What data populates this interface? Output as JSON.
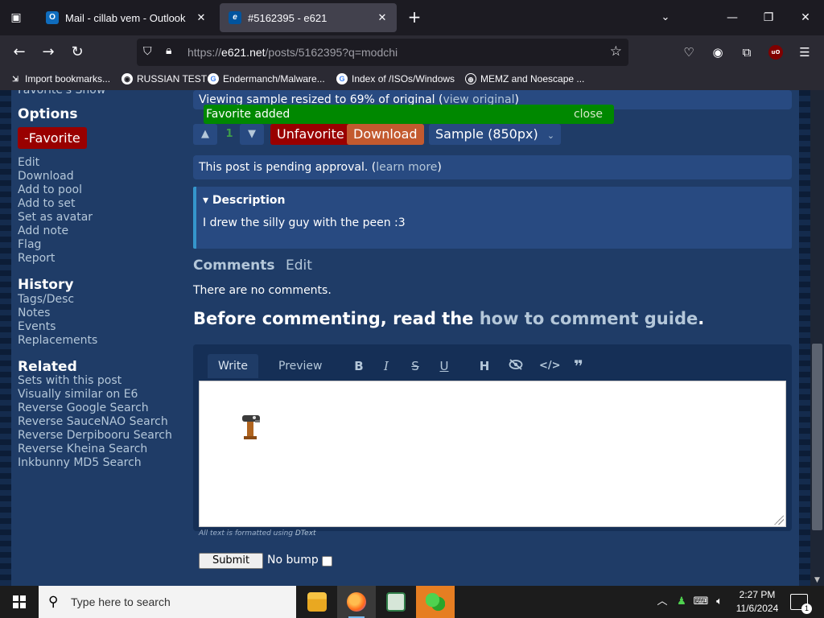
{
  "browser": {
    "tabs": [
      {
        "title": "Mail - cillab vem - Outlook",
        "favicon": "outlook-icon",
        "active": false
      },
      {
        "title": "#5162395 - e621",
        "favicon": "e621-icon",
        "active": true
      }
    ],
    "url": {
      "prefix": "https://",
      "host": "e621.net",
      "rest": "/posts/5162395?q=modchi"
    },
    "bookmarks": [
      {
        "label": "Import bookmarks...",
        "icon": "import-icon"
      },
      {
        "label": "RUSSIAN TEST",
        "icon": "github-icon"
      },
      {
        "label": "Endermanch/Malware...",
        "icon": "google-icon"
      },
      {
        "label": "Index of /ISOs/Windows",
        "icon": "google-icon"
      },
      {
        "label": "MEMZ and Noescape ...",
        "icon": "globe-icon"
      }
    ],
    "ublock_label": "uO"
  },
  "sidebar": {
    "cut_text": "Favorite's Show",
    "options_heading": "Options",
    "favorite_button": "-Favorite",
    "options": [
      "Edit",
      "Download",
      "Add to pool",
      "Add to set",
      "Set as avatar",
      "Add note",
      "Flag",
      "Report"
    ],
    "history_heading": "History",
    "history": [
      "Tags/Desc",
      "Notes",
      "Events",
      "Replacements"
    ],
    "related_heading": "Related",
    "related": [
      "Sets with this post",
      "Visually similar on E6",
      "Reverse Google Search",
      "Reverse SauceNAO Search",
      "Reverse Derpibooru Search",
      "Reverse Kheina Search",
      "Inkbunny MD5 Search"
    ]
  },
  "post": {
    "viewing_prefix": "Viewing sample resized to 69% of original (",
    "viewing_link": "view original",
    "viewing_suffix": ")",
    "notice": "Favorite added",
    "notice_close": "close",
    "vote_up": "▲",
    "vote_down": "▼",
    "score": "1",
    "unfavorite": "Unfavorite",
    "download": "Download",
    "sample_select": "Sample (850px)",
    "pending_prefix": "This post is pending approval. (",
    "pending_link": "learn more",
    "pending_suffix": ")",
    "description_heading": "▾ Description",
    "description_text": "I drew the silly guy with the peen :3"
  },
  "comments": {
    "tab_comments": "Comments",
    "tab_edit": "Edit",
    "empty": "There are no comments.",
    "guide_prefix": "Before commenting, read the ",
    "guide_link": "how to comment guide",
    "guide_suffix": ".",
    "editor_tabs": [
      "Write",
      "Preview"
    ],
    "toolbar": [
      "B",
      "I",
      "S",
      "U",
      "H",
      "spoiler",
      "code",
      "quote"
    ],
    "hint_prefix": "All text is formatted using ",
    "hint_link": "DText",
    "submit": "Submit",
    "no_bump": "No bump"
  },
  "taskbar": {
    "search_placeholder": "Type here to search",
    "time": "2:27 PM",
    "date": "11/6/2024",
    "notification_count": "1"
  }
}
